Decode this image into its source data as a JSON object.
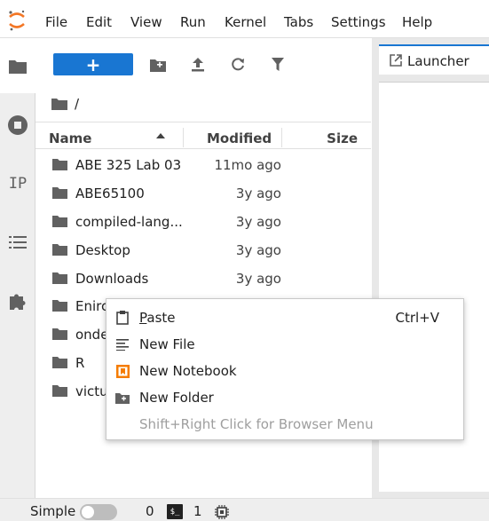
{
  "menubar": {
    "items": [
      "File",
      "Edit",
      "View",
      "Run",
      "Kernel",
      "Tabs",
      "Settings",
      "Help"
    ]
  },
  "toolbar": {
    "new_label": "+"
  },
  "breadcrumb": {
    "path": "/"
  },
  "file_table": {
    "columns": [
      "Name",
      "Modified",
      "Size"
    ],
    "rows": [
      {
        "name": "ABE 325 Lab 03",
        "modified": "11mo ago"
      },
      {
        "name": "ABE65100",
        "modified": "3y ago"
      },
      {
        "name": "compiled-lang...",
        "modified": "3y ago"
      },
      {
        "name": "Desktop",
        "modified": "3y ago"
      },
      {
        "name": "Downloads",
        "modified": "3y ago"
      },
      {
        "name": "Enirc",
        "modified": ""
      },
      {
        "name": "onde",
        "modified": ""
      },
      {
        "name": "R",
        "modified": ""
      },
      {
        "name": "victu",
        "modified": ""
      }
    ]
  },
  "main": {
    "tab_label": "Launcher"
  },
  "statusbar": {
    "mode_label": "Simple",
    "terminals_count": "0",
    "terminal_icon_text": "$_",
    "kernels_count": "1"
  },
  "context_menu": {
    "paste_first": "P",
    "paste_rest": "aste",
    "paste_shortcut": "Ctrl+V",
    "new_file": "New File",
    "new_notebook": "New Notebook",
    "new_folder": "New Folder",
    "browser_menu_hint": "Shift+Right Click for Browser Menu"
  },
  "colors": {
    "accent": "#1976d2",
    "notebook_orange": "#f57c00",
    "logo_orange": "#f37726"
  }
}
